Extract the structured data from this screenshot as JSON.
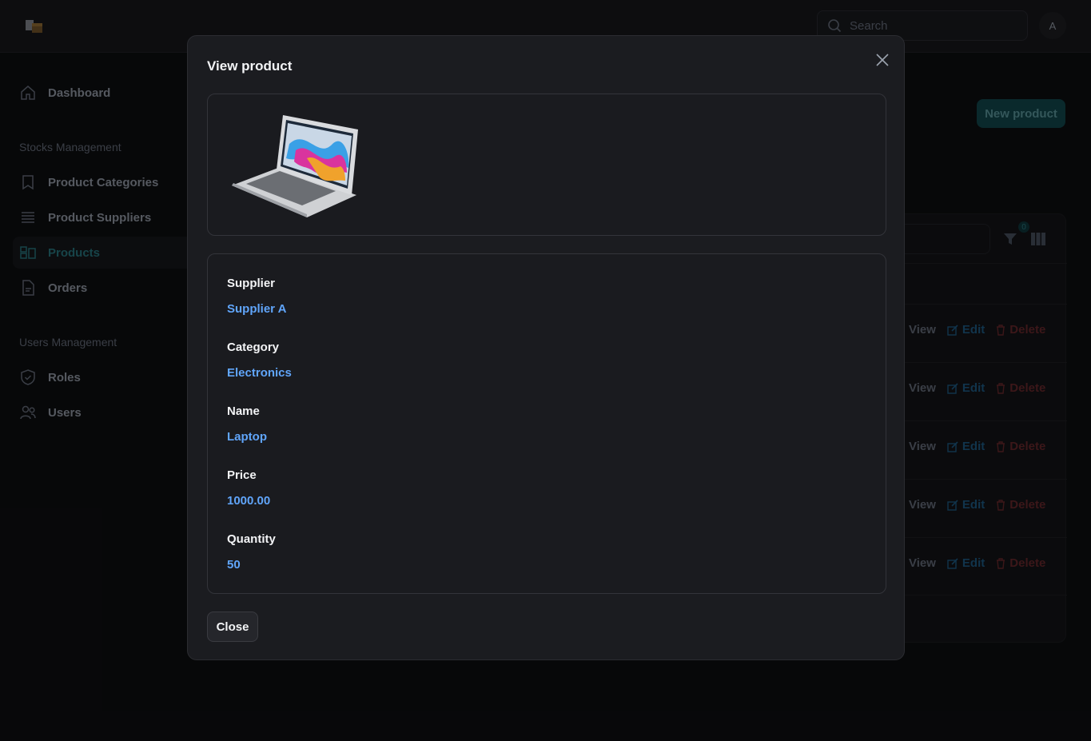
{
  "header": {
    "search_placeholder": "Search",
    "avatar_initial": "A"
  },
  "sidebar": {
    "dashboard": "Dashboard",
    "stocks_group": "Stocks Management",
    "product_categories": "Product Categories",
    "product_suppliers": "Product Suppliers",
    "products": "Products",
    "orders": "Orders",
    "users_group": "Users Management",
    "roles": "Roles",
    "users": "Users"
  },
  "main": {
    "new_product_label": "New product",
    "filter_count": "0",
    "row_actions": {
      "view": "View",
      "edit": "Edit",
      "delete": "Delete"
    }
  },
  "modal": {
    "title": "View product",
    "fields": [
      {
        "label": "Supplier",
        "value": "Supplier A"
      },
      {
        "label": "Category",
        "value": "Electronics"
      },
      {
        "label": "Name",
        "value": "Laptop"
      },
      {
        "label": "Price",
        "value": "1000.00"
      },
      {
        "label": "Quantity",
        "value": "50"
      }
    ],
    "close_label": "Close"
  },
  "colors": {
    "accent": "#2a7c86",
    "value_link": "#60a5fa",
    "danger": "#b91c1c"
  },
  "icons": [
    "logo-icon",
    "search-icon",
    "home-icon",
    "bookmark-icon",
    "stack-icon",
    "products-icon",
    "document-icon",
    "shield-icon",
    "users-icon",
    "filter-icon",
    "columns-icon",
    "eye-icon",
    "edit-icon",
    "trash-icon",
    "close-icon"
  ]
}
